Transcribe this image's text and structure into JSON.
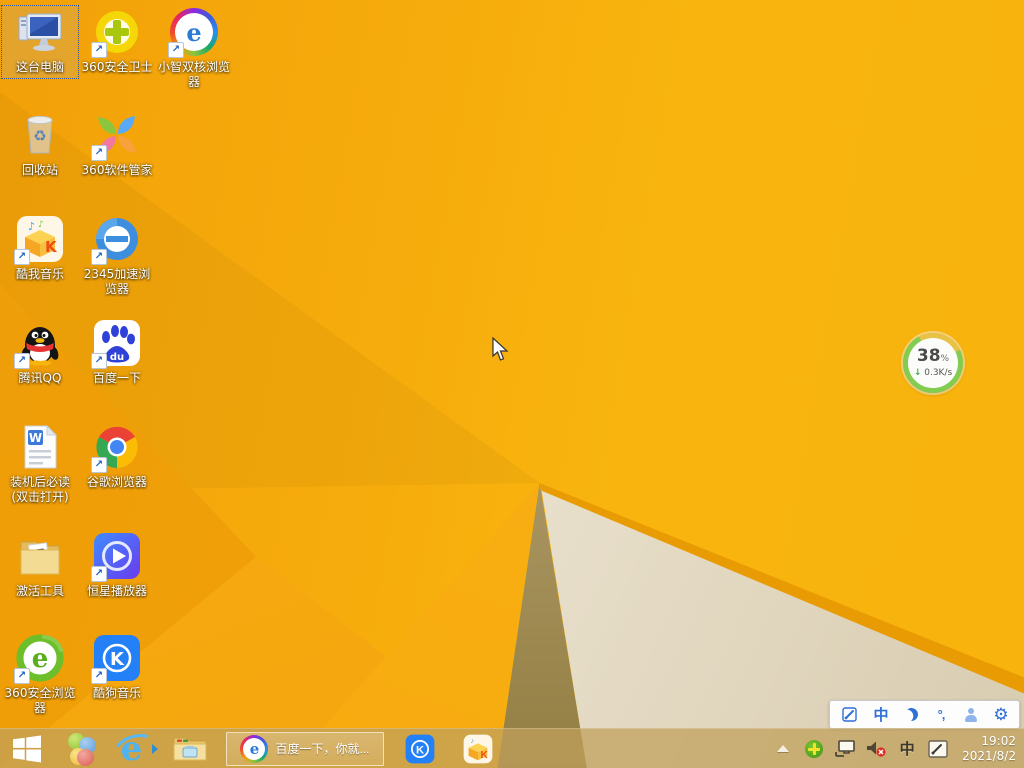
{
  "desktop": {
    "icons": [
      {
        "name": "this-pc",
        "label": "这台电脑",
        "selected": true
      },
      {
        "name": "360-safety-guard",
        "label": "360安全卫士"
      },
      {
        "name": "xiaozhi-dual-core-browser",
        "label": "小智双核浏览器"
      },
      {
        "name": "recycle-bin",
        "label": "回收站"
      },
      {
        "name": "360-software-manager",
        "label": "360软件管家"
      },
      {
        "name": "kuwo-music",
        "label": "酷我音乐"
      },
      {
        "name": "2345-speed-browser",
        "label": "2345加速浏览器"
      },
      {
        "name": "tencent-qq",
        "label": "腾讯QQ"
      },
      {
        "name": "baidu-search",
        "label": "百度一下"
      },
      {
        "name": "setup-readme",
        "label": "装机后必读(双击打开)"
      },
      {
        "name": "google-chrome",
        "label": "谷歌浏览器"
      },
      {
        "name": "activation-tool",
        "label": "激活工具"
      },
      {
        "name": "hengxing-player",
        "label": "恒星播放器"
      },
      {
        "name": "360-safe-browser",
        "label": "360安全浏览器"
      },
      {
        "name": "kugou-music",
        "label": "酷狗音乐"
      }
    ]
  },
  "speed_ball": {
    "percent": "38",
    "unit": "%",
    "down_arrow": "↓",
    "speed": "0.3K/s"
  },
  "taskbar": {
    "running_task": {
      "label": "百度一下，你就..."
    },
    "tray": {
      "ime_indicator": "中"
    },
    "clock": {
      "time": "19:02",
      "date": "2021/8/2"
    }
  },
  "ime_bar": {
    "chinese_mode": "中",
    "punctuation": "°,",
    "gear_glyph": "⚙"
  },
  "colors": {
    "wallpaper_orange": "#F7AE0D",
    "wallpaper_cream": "#F0EBDD",
    "taskbar_tan": "#C5A76A",
    "ball_ring_green": "#82CC51",
    "ball_ring_yellow": "#E8C247",
    "ime_blue": "#2E6FD8"
  }
}
